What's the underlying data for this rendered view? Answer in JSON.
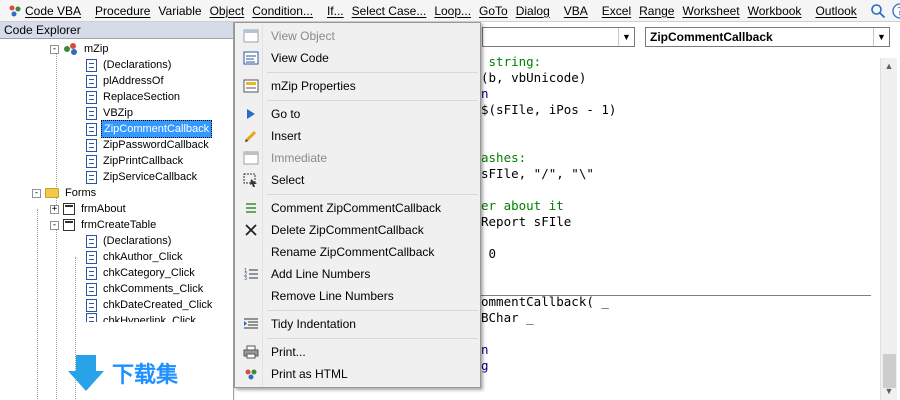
{
  "toolbar": {
    "logo": "Code VBA",
    "groups": [
      [
        "Procedure",
        "Variable",
        "Object",
        "Condition..."
      ],
      [
        "If...",
        "Select Case...",
        "Loop...",
        "GoTo",
        "Dialog"
      ],
      [
        "VBA"
      ],
      [
        "Excel",
        "Range",
        "Worksheet",
        "Workbook"
      ],
      [
        "Outlook"
      ]
    ]
  },
  "explorer": {
    "title": "Code Explorer",
    "items": [
      {
        "label": "mZip",
        "type": "module",
        "expander": "-"
      },
      {
        "label": "(Declarations)",
        "type": "doc"
      },
      {
        "label": "plAddressOf",
        "type": "doc"
      },
      {
        "label": "ReplaceSection",
        "type": "doc"
      },
      {
        "label": "VBZip",
        "type": "doc"
      },
      {
        "label": "ZipCommentCallback",
        "type": "doc",
        "selected": true
      },
      {
        "label": "ZipPasswordCallback",
        "type": "doc"
      },
      {
        "label": "ZipPrintCallback",
        "type": "doc"
      },
      {
        "label": "ZipServiceCallback",
        "type": "doc"
      },
      {
        "label": "Forms",
        "type": "folder",
        "expander": "-"
      },
      {
        "label": "frmAbout",
        "type": "form",
        "expander": "+"
      },
      {
        "label": "frmCreateTable",
        "type": "form",
        "expander": "-"
      },
      {
        "label": "(Declarations)",
        "type": "doc"
      },
      {
        "label": "chkAuthor_Click",
        "type": "doc"
      },
      {
        "label": "chkCategory_Click",
        "type": "doc"
      },
      {
        "label": "chkComments_Click",
        "type": "doc"
      },
      {
        "label": "chkDateCreated_Click",
        "type": "doc"
      },
      {
        "label": "chkHyperlink_Click",
        "type": "doc"
      }
    ],
    "watermark": "下载集"
  },
  "editor": {
    "object_combo": "",
    "procedure_combo": "ZipCommentCallback",
    "lines": [
      {
        "text": " string:",
        "style": "comment"
      },
      {
        "text": "(b, vbUnicode)",
        "style": "normal"
      },
      {
        "text": "n",
        "style": "keyword"
      },
      {
        "text": "$(sFIle, iPos - 1)",
        "style": "normal"
      },
      {
        "text": "",
        "style": "normal"
      },
      {
        "text": "",
        "style": "normal"
      },
      {
        "text": "ashes:",
        "style": "comment"
      },
      {
        "text": "sFIle, \"/\", \"\\\"",
        "style": "normal"
      },
      {
        "text": "",
        "style": "normal"
      },
      {
        "text": "er about it",
        "style": "comment"
      },
      {
        "text": "Report sFIle",
        "style": "normal"
      },
      {
        "text": "",
        "style": "normal"
      },
      {
        "text": " 0",
        "style": "normal"
      },
      {
        "text": "",
        "style": "normal"
      },
      {
        "text": "",
        "style": "normal"
      },
      {
        "text": "ommentCallback( _",
        "style": "normal"
      },
      {
        "text": "BChar _",
        "style": "normal"
      },
      {
        "text": "",
        "style": "normal"
      },
      {
        "text": "n",
        "style": "keyword"
      },
      {
        "text": "g",
        "style": "keyword"
      }
    ]
  },
  "context_menu": {
    "items": [
      {
        "label": "View Object",
        "icon": "view-object-icon",
        "disabled": true
      },
      {
        "label": "View Code",
        "icon": "view-code-icon",
        "disabled": false
      },
      {
        "label": "mZip Properties",
        "icon": "properties-icon",
        "disabled": false,
        "sep_before": true
      },
      {
        "label": "Go to",
        "icon": "goto-arrow-icon",
        "disabled": false,
        "sep_before": true
      },
      {
        "label": "Insert",
        "icon": "insert-pencil-icon",
        "disabled": false
      },
      {
        "label": "Immediate",
        "icon": "immediate-window-icon",
        "disabled": true
      },
      {
        "label": "Select",
        "icon": "select-icon",
        "disabled": false
      },
      {
        "label": "Comment ZipCommentCallback",
        "icon": "comment-icon",
        "disabled": false,
        "sep_before": true
      },
      {
        "label": "Delete ZipCommentCallback",
        "icon": "delete-x-icon",
        "disabled": false
      },
      {
        "label": "Rename ZipCommentCallback",
        "icon": "",
        "disabled": false
      },
      {
        "label": "Add Line Numbers",
        "icon": "line-numbers-icon",
        "disabled": false
      },
      {
        "label": "Remove Line Numbers",
        "icon": "",
        "disabled": false
      },
      {
        "label": "Tidy Indentation",
        "icon": "indent-icon",
        "disabled": false,
        "sep_before": true
      },
      {
        "label": "Print...",
        "icon": "printer-icon",
        "disabled": false,
        "sep_before": true
      },
      {
        "label": "Print as HTML",
        "icon": "print-html-icon",
        "disabled": false
      }
    ]
  }
}
